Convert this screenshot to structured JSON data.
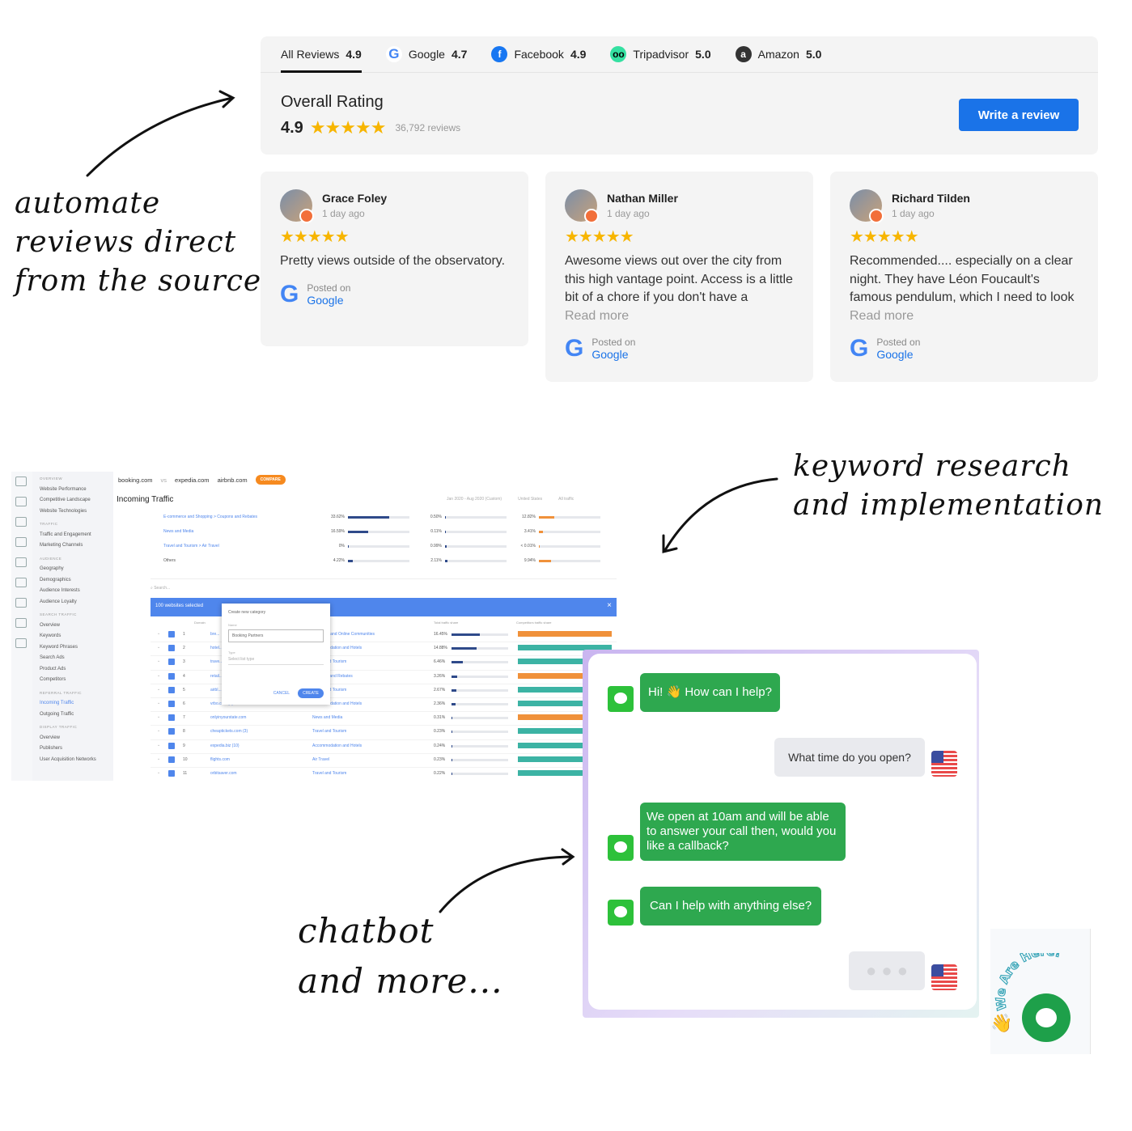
{
  "captions": {
    "reviews": [
      "automate",
      "reviews direct",
      "from the source"
    ],
    "keywords": [
      "keyword research",
      "and implementation"
    ],
    "chatbot": [
      "chatbot",
      "and more..."
    ]
  },
  "reviews_widget": {
    "tabs": [
      {
        "label": "All Reviews",
        "rating": "4.9",
        "icon": "none"
      },
      {
        "label": "Google",
        "rating": "4.7",
        "icon": "google-icon"
      },
      {
        "label": "Facebook",
        "rating": "4.9",
        "icon": "facebook-icon"
      },
      {
        "label": "Tripadvisor",
        "rating": "5.0",
        "icon": "tripadvisor-icon"
      },
      {
        "label": "Amazon",
        "rating": "5.0",
        "icon": "amazon-icon"
      }
    ],
    "overall_label": "Overall Rating",
    "overall_rating": "4.9",
    "stars": 5,
    "review_count": "36,792",
    "review_count_suffix": "reviews",
    "write_button": "Write a review",
    "cards": [
      {
        "name": "Grace Foley",
        "time": "1 day ago",
        "stars": 5,
        "text": "Pretty views outside of the observatory.",
        "more": "",
        "posted_label": "Posted on",
        "source": "Google"
      },
      {
        "name": "Nathan Miller",
        "time": "1 day ago",
        "stars": 5,
        "text": "Awesome views out over the city from this high vantage point. Access is a little bit of a chore if you don't have a",
        "more": "Read more",
        "posted_label": "Posted on",
        "source": "Google"
      },
      {
        "name": "Richard Tilden",
        "time": "1 day ago",
        "stars": 5,
        "text": "Recommended.... especially on a clear night. They have Léon Foucault's famous pendulum, which I need to look",
        "more": "Read more",
        "posted_label": "Posted on",
        "source": "Google"
      }
    ],
    "accent": "#1a73e8",
    "star_color": "#f7b500"
  },
  "dashboard": {
    "compare_sites": [
      "booking.com",
      "vs",
      "expedia.com",
      "airbnb.com"
    ],
    "compare_button": "COMPARE",
    "title": "Incoming Traffic",
    "date_range": "Jan 2020 - Aug 2020 (Custom)",
    "country": "United States",
    "traffic_filter": "All traffic",
    "sidebar": [
      {
        "h": "OVERVIEW",
        "items": [
          "Website Performance",
          "Competitive Landscape",
          "Website Technologies"
        ]
      },
      {
        "h": "TRAFFIC",
        "items": [
          "Traffic and Engagement",
          "Marketing Channels"
        ]
      },
      {
        "h": "AUDIENCE",
        "items": [
          "Geography",
          "Demographics",
          "Audience Interests",
          "Audience Loyalty"
        ]
      },
      {
        "h": "SEARCH TRAFFIC",
        "items": [
          "Overview",
          "Keywords",
          "Keyword Phrases",
          "Search Ads",
          "Product Ads",
          "Competitors"
        ]
      },
      {
        "h": "REFERRAL TRAFFIC",
        "items": [
          "Incoming Traffic",
          "Outgoing Traffic"
        ]
      },
      {
        "h": "DISPLAY TRAFFIC",
        "items": [
          "Overview",
          "Publishers",
          "User Acquisition Networks"
        ]
      }
    ],
    "summary": [
      {
        "cat": "E-commerce and Shopping > Coupons and Rebates",
        "a": "33.62%",
        "b": "0.50%",
        "c": "12.82%",
        "av": 33.62,
        "bv": 0.5,
        "cv": 12.82
      },
      {
        "cat": "News and Media",
        "a": "16.59%",
        "b": "0.11%",
        "c": "3.41%",
        "av": 16.59,
        "bv": 0.11,
        "cv": 3.41
      },
      {
        "cat": "Travel and Tourism > Air Travel",
        "a": "0%",
        "b": "0.99%",
        "c": "< 0.01%",
        "av": 0,
        "bv": 0.99,
        "cv": 0
      },
      {
        "cat": "Others",
        "a": "4.22%",
        "b": "2.11%",
        "c": "9.94%",
        "av": 4.22,
        "bv": 2.11,
        "cv": 9.94
      }
    ],
    "search_placeholder": "Search...",
    "selected_label": "100 websites selected",
    "modal": {
      "create_label": "Create new category",
      "name_label": "Name",
      "name_value": "Booking Partners",
      "type_label": "Type",
      "type_placeholder": "Select list type",
      "cancel": "CANCEL",
      "create": "CREATE"
    },
    "columns": [
      "Domain",
      "Total traffic share",
      "Competitors traffic share"
    ],
    "rows": [
      {
        "n": "1",
        "domain": "bre...",
        "cat": "Networks and Online Communities",
        "share": "16.45%",
        "v": 16.45,
        "comp": "orange"
      },
      {
        "n": "2",
        "domain": "hotel...",
        "cat": "Accommodation and Hotels",
        "share": "14.88%",
        "v": 14.88,
        "comp": "teal"
      },
      {
        "n": "3",
        "domain": "trave...",
        "cat": "Travel and Tourism",
        "share": "6.46%",
        "v": 6.46,
        "comp": "teal"
      },
      {
        "n": "4",
        "domain": "retail...",
        "cat": "Coupons and Rebates",
        "share": "3.26%",
        "v": 3.26,
        "comp": "orange"
      },
      {
        "n": "5",
        "domain": "airbl...",
        "cat": "Travel and Tourism",
        "share": "2.67%",
        "v": 2.67,
        "comp": "teal"
      },
      {
        "n": "6",
        "domain": "vrbo.com (2)",
        "cat": "Accommodation and Hotels",
        "share": "2.36%",
        "v": 2.36,
        "comp": "teal"
      },
      {
        "n": "7",
        "domain": "onlyinyourstate.com",
        "cat": "News and Media",
        "share": "0.31%",
        "v": 0.31,
        "comp": "orange"
      },
      {
        "n": "8",
        "domain": "cheaptickets.com (3)",
        "cat": "Travel and Tourism",
        "share": "0.23%",
        "v": 0.23,
        "comp": "teal"
      },
      {
        "n": "9",
        "domain": "expedia.biz (10)",
        "cat": "Accommodation and Hotels",
        "share": "0.24%",
        "v": 0.24,
        "comp": "teal"
      },
      {
        "n": "10",
        "domain": "flights.com",
        "cat": "Air Travel",
        "share": "0.23%",
        "v": 0.23,
        "comp": "teal"
      },
      {
        "n": "11",
        "domain": "orbitsaver.com",
        "cat": "Travel and Tourism",
        "share": "0.22%",
        "v": 0.22,
        "comp": "teal"
      }
    ]
  },
  "chat": {
    "messages": [
      {
        "from": "bot",
        "text": "Hi! 👋 How can I help?"
      },
      {
        "from": "user",
        "text": "What time do you open?"
      },
      {
        "from": "bot",
        "text": "We open at 10am and will be able to answer your call then, would you like a callback?"
      },
      {
        "from": "bot",
        "text": "Can I help with anything else?"
      }
    ],
    "launcher_text": "We Are Here!",
    "bot_color": "#2ea84f"
  }
}
